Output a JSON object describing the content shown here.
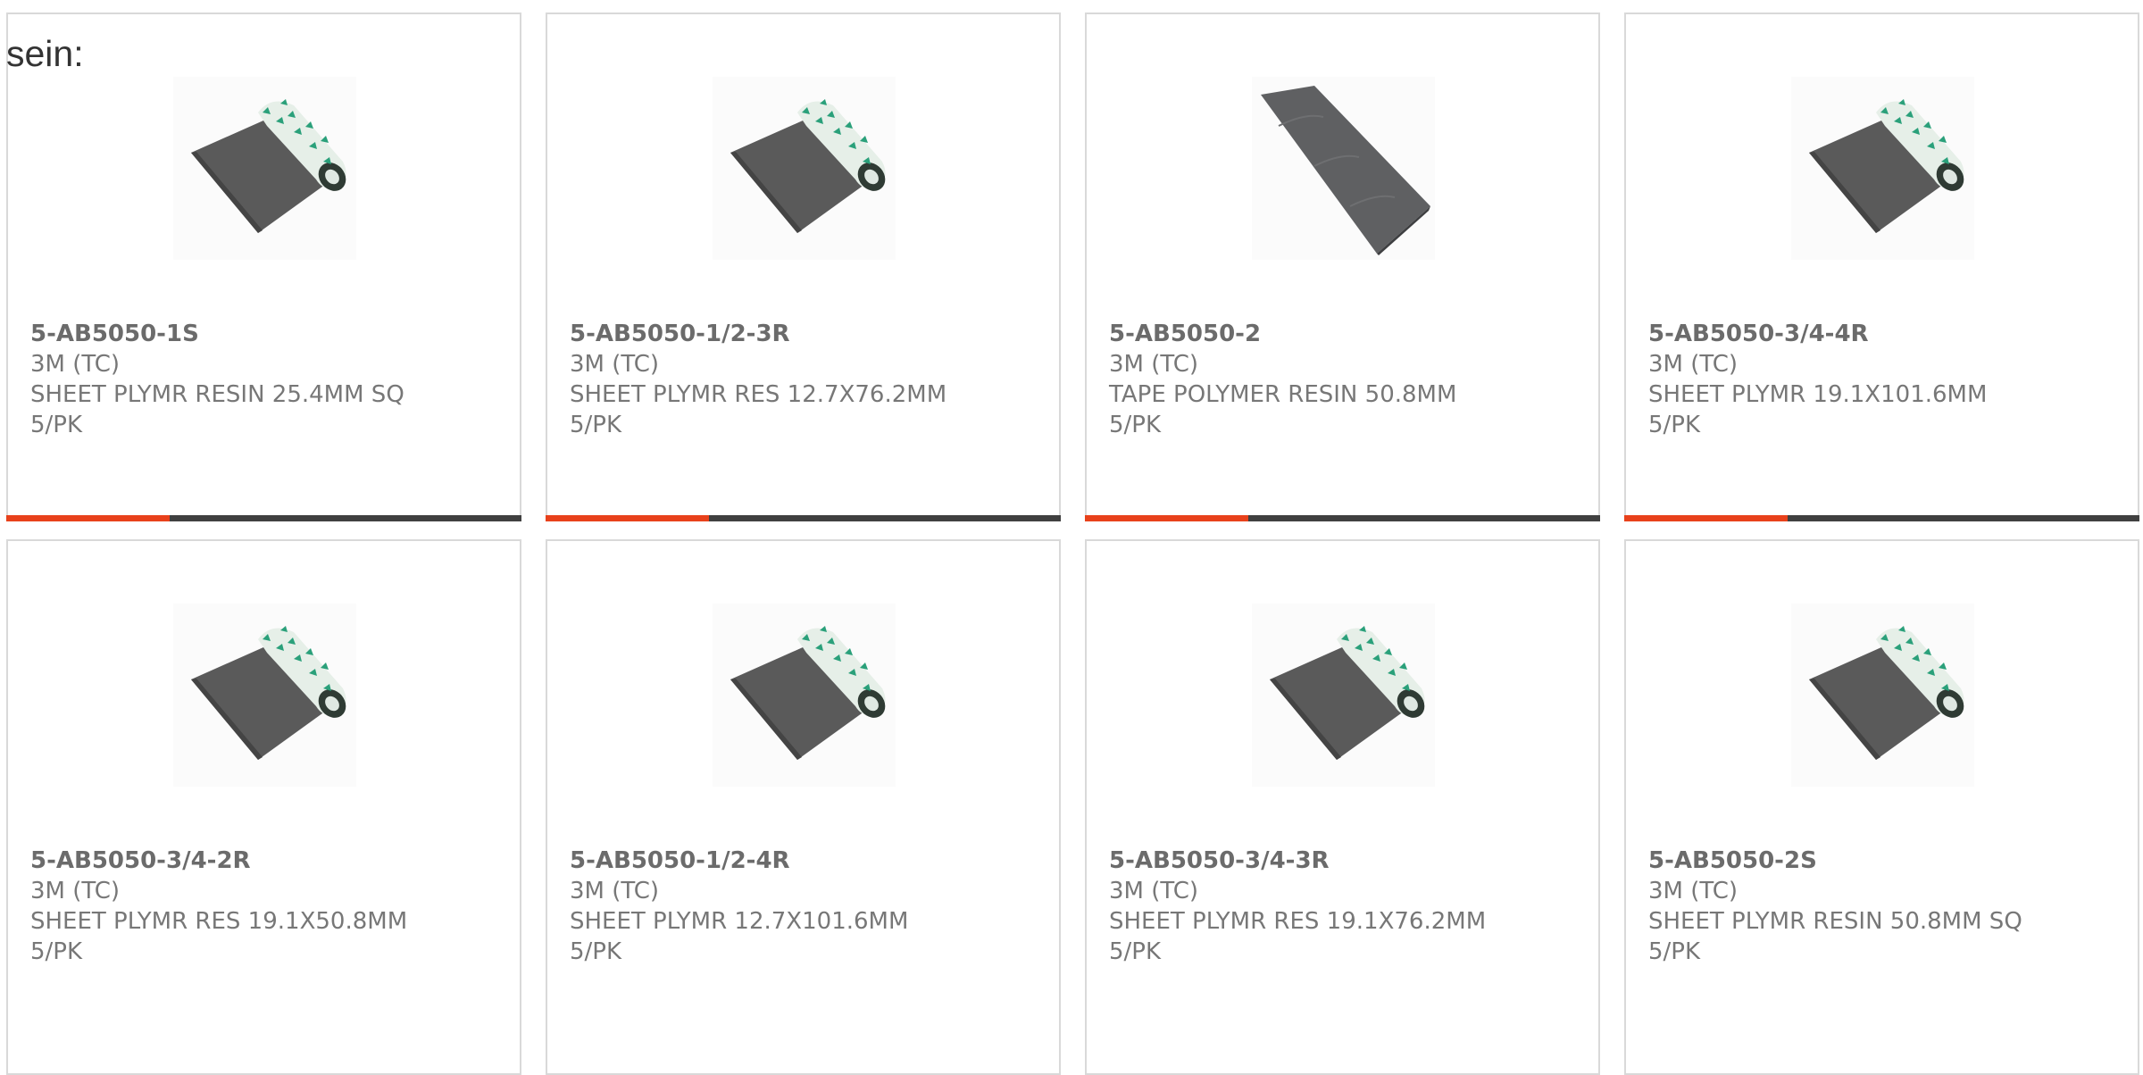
{
  "intro_text": "sein:",
  "products": [
    {
      "part_number": "5-AB5050-1S",
      "manufacturer": "3M (TC)",
      "description": "SHEET PLYMR RESIN 25.4MM SQ",
      "package": "5/PK",
      "image": "roll-sheet"
    },
    {
      "part_number": "5-AB5050-1/2-3R",
      "manufacturer": "3M (TC)",
      "description": "SHEET PLYMR RES 12.7X76.2MM",
      "package": "5/PK",
      "image": "roll-sheet"
    },
    {
      "part_number": "5-AB5050-2",
      "manufacturer": "3M (TC)",
      "description": "TAPE POLYMER RESIN 50.8MM",
      "package": "5/PK",
      "image": "tape-strip"
    },
    {
      "part_number": "5-AB5050-3/4-4R",
      "manufacturer": "3M (TC)",
      "description": "SHEET PLYMR 19.1X101.6MM",
      "package": "5/PK",
      "image": "roll-sheet"
    },
    {
      "part_number": "5-AB5050-3/4-2R",
      "manufacturer": "3M (TC)",
      "description": "SHEET PLYMR RES 19.1X50.8MM",
      "package": "5/PK",
      "image": "roll-sheet"
    },
    {
      "part_number": "5-AB5050-1/2-4R",
      "manufacturer": "3M (TC)",
      "description": "SHEET PLYMR 12.7X101.6MM",
      "package": "5/PK",
      "image": "roll-sheet"
    },
    {
      "part_number": "5-AB5050-3/4-3R",
      "manufacturer": "3M (TC)",
      "description": "SHEET PLYMR RES 19.1X76.2MM",
      "package": "5/PK",
      "image": "roll-sheet"
    },
    {
      "part_number": "5-AB5050-2S",
      "manufacturer": "3M (TC)",
      "description": "SHEET PLYMR RESIN 50.8MM SQ",
      "package": "5/PK",
      "image": "roll-sheet"
    }
  ],
  "colors": {
    "accent": "#e8411b",
    "bar_dark": "#404040",
    "text": "#777777",
    "border": "#d9d9d9"
  }
}
